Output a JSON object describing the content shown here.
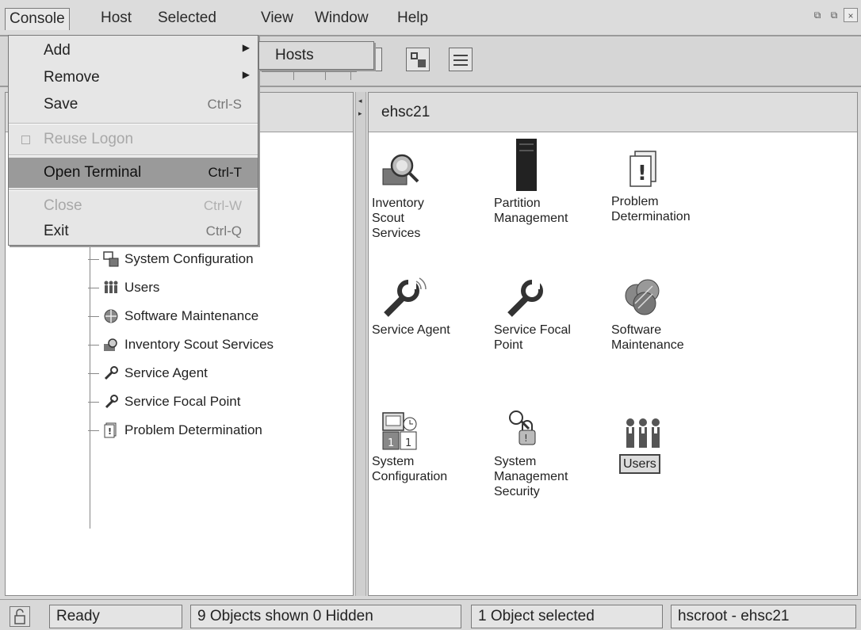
{
  "menubar": {
    "items": [
      "Console",
      "Host",
      "Selected",
      "View",
      "Window",
      "Help"
    ]
  },
  "console_menu": {
    "add": "Add",
    "remove": "Remove",
    "save": "Save",
    "save_shortcut": "Ctrl-S",
    "reuse_logon": "Reuse Logon",
    "open_terminal": "Open Terminal",
    "open_terminal_shortcut": "Ctrl-T",
    "close": "Close",
    "close_shortcut": "Ctrl-W",
    "exit": "Exit",
    "exit_shortcut": "Ctrl-Q"
  },
  "add_submenu": {
    "hosts": "Hosts"
  },
  "tree": {
    "items": [
      {
        "label": "System Configuration",
        "icon": "system-configuration-icon"
      },
      {
        "label": "Users",
        "icon": "users-icon"
      },
      {
        "label": "Software Maintenance",
        "icon": "software-maintenance-icon"
      },
      {
        "label": "Inventory Scout Services",
        "icon": "inventory-scout-icon"
      },
      {
        "label": "Service Agent",
        "icon": "service-agent-icon"
      },
      {
        "label": "Service Focal Point",
        "icon": "service-focal-point-icon"
      },
      {
        "label": "Problem Determination",
        "icon": "problem-determination-icon"
      }
    ]
  },
  "content": {
    "title": "ehsc21",
    "tiles": [
      {
        "label": "Inventory\nScout\nServices",
        "icon": "inventory-scout-icon"
      },
      {
        "label": "Partition\nManagement",
        "icon": "partition-management-icon"
      },
      {
        "label": "Problem\nDetermination",
        "icon": "problem-determination-icon"
      },
      {
        "label": "Service Agent",
        "icon": "service-agent-icon"
      },
      {
        "label": "Service Focal\nPoint",
        "icon": "service-focal-point-icon"
      },
      {
        "label": "Software\nMaintenance",
        "icon": "software-maintenance-icon"
      },
      {
        "label": "System\nConfiguration",
        "icon": "system-configuration-icon"
      },
      {
        "label": "System\nManagement\nSecurity",
        "icon": "system-management-security-icon"
      },
      {
        "label": "Users",
        "icon": "users-icon",
        "selected": true
      }
    ]
  },
  "status": {
    "ready": "Ready",
    "objects": "9 Objects shown 0 Hidden",
    "selected": "1 Object selected",
    "user": "hscroot - ehsc21"
  }
}
